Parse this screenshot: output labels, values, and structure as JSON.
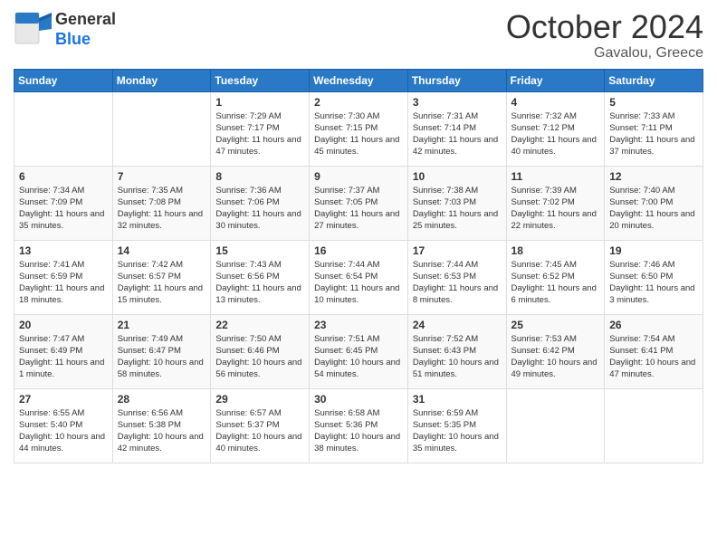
{
  "logo": {
    "general": "General",
    "blue": "Blue"
  },
  "title": "October 2024",
  "subtitle": "Gavalou, Greece",
  "weekdays": [
    "Sunday",
    "Monday",
    "Tuesday",
    "Wednesday",
    "Thursday",
    "Friday",
    "Saturday"
  ],
  "weeks": [
    [
      {
        "day": "",
        "info": ""
      },
      {
        "day": "",
        "info": ""
      },
      {
        "day": "1",
        "info": "Sunrise: 7:29 AM\nSunset: 7:17 PM\nDaylight: 11 hours and 47 minutes."
      },
      {
        "day": "2",
        "info": "Sunrise: 7:30 AM\nSunset: 7:15 PM\nDaylight: 11 hours and 45 minutes."
      },
      {
        "day": "3",
        "info": "Sunrise: 7:31 AM\nSunset: 7:14 PM\nDaylight: 11 hours and 42 minutes."
      },
      {
        "day": "4",
        "info": "Sunrise: 7:32 AM\nSunset: 7:12 PM\nDaylight: 11 hours and 40 minutes."
      },
      {
        "day": "5",
        "info": "Sunrise: 7:33 AM\nSunset: 7:11 PM\nDaylight: 11 hours and 37 minutes."
      }
    ],
    [
      {
        "day": "6",
        "info": "Sunrise: 7:34 AM\nSunset: 7:09 PM\nDaylight: 11 hours and 35 minutes."
      },
      {
        "day": "7",
        "info": "Sunrise: 7:35 AM\nSunset: 7:08 PM\nDaylight: 11 hours and 32 minutes."
      },
      {
        "day": "8",
        "info": "Sunrise: 7:36 AM\nSunset: 7:06 PM\nDaylight: 11 hours and 30 minutes."
      },
      {
        "day": "9",
        "info": "Sunrise: 7:37 AM\nSunset: 7:05 PM\nDaylight: 11 hours and 27 minutes."
      },
      {
        "day": "10",
        "info": "Sunrise: 7:38 AM\nSunset: 7:03 PM\nDaylight: 11 hours and 25 minutes."
      },
      {
        "day": "11",
        "info": "Sunrise: 7:39 AM\nSunset: 7:02 PM\nDaylight: 11 hours and 22 minutes."
      },
      {
        "day": "12",
        "info": "Sunrise: 7:40 AM\nSunset: 7:00 PM\nDaylight: 11 hours and 20 minutes."
      }
    ],
    [
      {
        "day": "13",
        "info": "Sunrise: 7:41 AM\nSunset: 6:59 PM\nDaylight: 11 hours and 18 minutes."
      },
      {
        "day": "14",
        "info": "Sunrise: 7:42 AM\nSunset: 6:57 PM\nDaylight: 11 hours and 15 minutes."
      },
      {
        "day": "15",
        "info": "Sunrise: 7:43 AM\nSunset: 6:56 PM\nDaylight: 11 hours and 13 minutes."
      },
      {
        "day": "16",
        "info": "Sunrise: 7:44 AM\nSunset: 6:54 PM\nDaylight: 11 hours and 10 minutes."
      },
      {
        "day": "17",
        "info": "Sunrise: 7:44 AM\nSunset: 6:53 PM\nDaylight: 11 hours and 8 minutes."
      },
      {
        "day": "18",
        "info": "Sunrise: 7:45 AM\nSunset: 6:52 PM\nDaylight: 11 hours and 6 minutes."
      },
      {
        "day": "19",
        "info": "Sunrise: 7:46 AM\nSunset: 6:50 PM\nDaylight: 11 hours and 3 minutes."
      }
    ],
    [
      {
        "day": "20",
        "info": "Sunrise: 7:47 AM\nSunset: 6:49 PM\nDaylight: 11 hours and 1 minute."
      },
      {
        "day": "21",
        "info": "Sunrise: 7:49 AM\nSunset: 6:47 PM\nDaylight: 10 hours and 58 minutes."
      },
      {
        "day": "22",
        "info": "Sunrise: 7:50 AM\nSunset: 6:46 PM\nDaylight: 10 hours and 56 minutes."
      },
      {
        "day": "23",
        "info": "Sunrise: 7:51 AM\nSunset: 6:45 PM\nDaylight: 10 hours and 54 minutes."
      },
      {
        "day": "24",
        "info": "Sunrise: 7:52 AM\nSunset: 6:43 PM\nDaylight: 10 hours and 51 minutes."
      },
      {
        "day": "25",
        "info": "Sunrise: 7:53 AM\nSunset: 6:42 PM\nDaylight: 10 hours and 49 minutes."
      },
      {
        "day": "26",
        "info": "Sunrise: 7:54 AM\nSunset: 6:41 PM\nDaylight: 10 hours and 47 minutes."
      }
    ],
    [
      {
        "day": "27",
        "info": "Sunrise: 6:55 AM\nSunset: 5:40 PM\nDaylight: 10 hours and 44 minutes."
      },
      {
        "day": "28",
        "info": "Sunrise: 6:56 AM\nSunset: 5:38 PM\nDaylight: 10 hours and 42 minutes."
      },
      {
        "day": "29",
        "info": "Sunrise: 6:57 AM\nSunset: 5:37 PM\nDaylight: 10 hours and 40 minutes."
      },
      {
        "day": "30",
        "info": "Sunrise: 6:58 AM\nSunset: 5:36 PM\nDaylight: 10 hours and 38 minutes."
      },
      {
        "day": "31",
        "info": "Sunrise: 6:59 AM\nSunset: 5:35 PM\nDaylight: 10 hours and 35 minutes."
      },
      {
        "day": "",
        "info": ""
      },
      {
        "day": "",
        "info": ""
      }
    ]
  ]
}
